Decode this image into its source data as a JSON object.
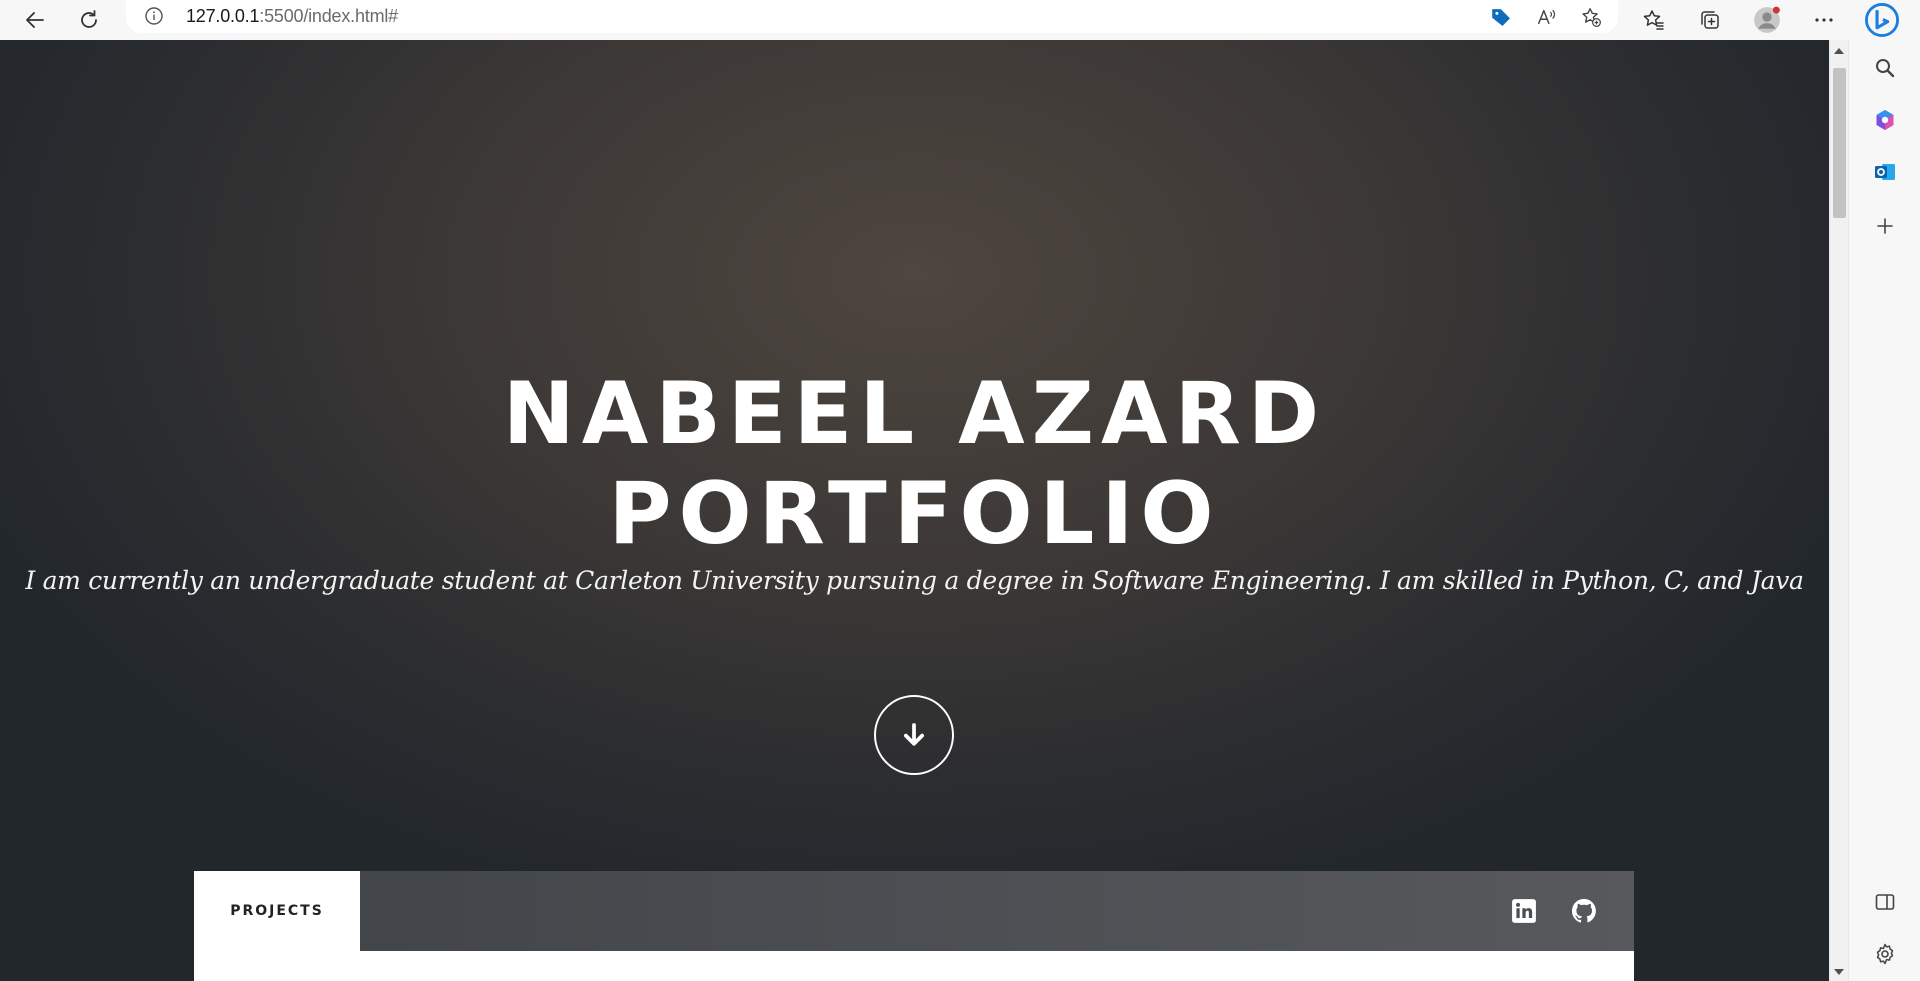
{
  "browser": {
    "url_host": "127.0.0.1",
    "url_rest": ":5500/index.html#",
    "icons": [
      "back-icon",
      "refresh-icon",
      "info-icon",
      "tag-icon",
      "read-aloud-icon",
      "add-favorite-icon",
      "favorites-icon",
      "collections-icon",
      "profile-icon",
      "more-icon",
      "bing-icon"
    ]
  },
  "sidebar": {
    "icons": [
      "search-icon",
      "copilot-icon",
      "outlook-icon",
      "add-icon",
      "split-screen-icon",
      "settings-icon"
    ]
  },
  "hero": {
    "title_line1": "NABEEL AZARD",
    "title_line2": "PORTFOLIO",
    "subtitle": "I am currently an undergraduate student at Carleton University pursuing a degree in Software Engineering. I am skilled in Python, C, and Java"
  },
  "nav": {
    "projects_label": "PROJECTS",
    "social_icons": [
      "linkedin-icon",
      "github-icon"
    ]
  },
  "colors": {
    "hero_bg": "#3a3634",
    "navbar_bg": "#4b4e52",
    "accent_blue": "#0f6cbd",
    "text_white": "#ffffff"
  }
}
